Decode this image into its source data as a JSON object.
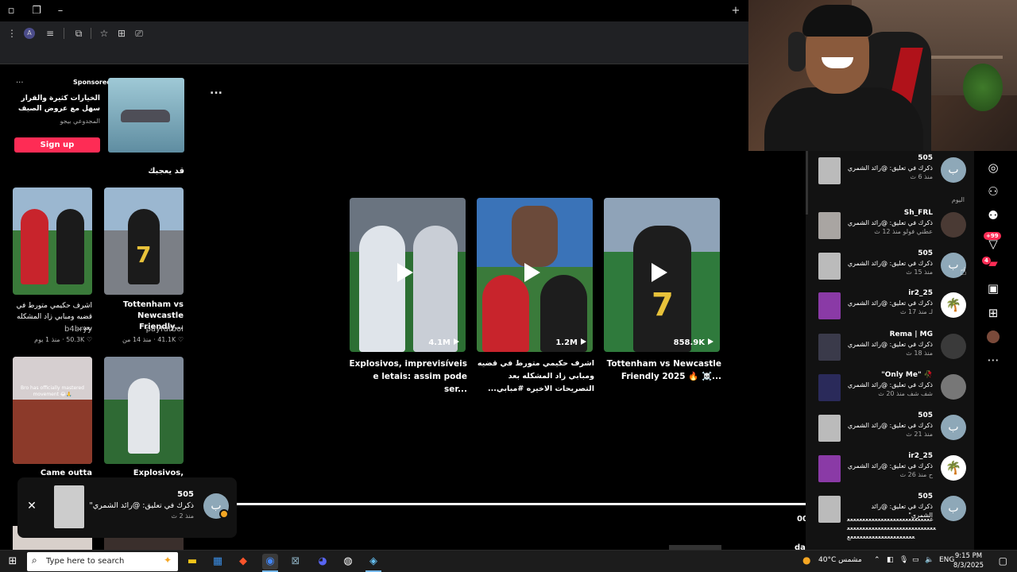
{
  "browser": {
    "titlebar_icons": [
      "browser-tabs-icon",
      "minimize-icon"
    ],
    "new_tab": "+",
    "toolbar_icons": [
      "menu-icon",
      "profile-icon",
      "reader-icon",
      "extensions-icon",
      "star-icon",
      "collections-icon",
      "screenshot-icon"
    ]
  },
  "sponsored": {
    "label": "Sponsored",
    "dots": "...",
    "text": "الخيارات كثيرة والقرار سهل مع عروض الصيف",
    "advertiser": "المجدوعي بيجو",
    "button": "Sign up"
  },
  "more_dots": "...",
  "suggested_title": "قد يعجبك",
  "grid": [
    {
      "title": "اشرف حكيمي متورط في قضيه ومبابي زاد المشكله بعد...",
      "author": "b4bryy",
      "likes": "50.3K",
      "time": "منذ 1 يوم"
    },
    {
      "title": "Tottenham vs Newcastle Friendly...",
      "author": "payfutbol",
      "likes": "41.1K",
      "time": "منذ 14 من"
    },
    {
      "title": "Came outta",
      "overlay": "Bro has officially mastered movement 😂🙏"
    },
    {
      "title": "Explosivos,"
    }
  ],
  "videos": [
    {
      "views": "4.1M",
      "title": "Explosivos, imprevisíveis e letais: assim pode ser..."
    },
    {
      "views": "1.2M",
      "title": "اشرف حكيمي متورط في قضيه ومبابي زاد المشكله بعد التصريحات الاخيره #مبابي..."
    },
    {
      "views": "858.9K",
      "title": "Tottenham vs Newcastle Friendly 2025 🔥 ☠️..."
    }
  ],
  "jersey_number": "7",
  "partial_time": "00",
  "partial_da": "da",
  "toast": {
    "name": "505",
    "text": "ذكرك في تعليق: @رائد الشمري\"",
    "time": "منذ 2 ث",
    "avatar_letter": "ب",
    "close": "✕"
  },
  "notifications": {
    "section_today": "اليوم",
    "items": [
      {
        "name": "505",
        "text": "ذكرك في تعليق: @رائد الشمري",
        "time": "منذ 6 ث",
        "avatar": "ب"
      },
      {
        "name": "Sh_FRL",
        "text": "ذكرك في تعليق: @رائد الشمري",
        "time": "عطني فولو منذ 12 ث",
        "avatar": ""
      },
      {
        "name": "505",
        "text": "ذكرك في تعليق: @رائد الشمري",
        "time": "منذ 15 ث",
        "avatar": "ب"
      },
      {
        "name": "ir2_25",
        "text": "ذكرك في تعليق: @رائد الشمري",
        "time": "لـ منذ 17 ث",
        "avatar": "🌴"
      },
      {
        "name": "Rema | MG",
        "text": "ذكرك في تعليق: @رائد الشمري",
        "time": "منذ 18 ث",
        "avatar": ""
      },
      {
        "name": "\"Only Me\" 🥀",
        "text": "ذكرك في تعليق: @رائد الشمري",
        "time": "شف شف منذ 20 ث",
        "avatar": ""
      },
      {
        "name": "505",
        "text": "ذكرك في تعليق: @رائد الشمري",
        "time": "منذ 21 ث",
        "avatar": "ب"
      },
      {
        "name": "ir2_25",
        "text": "ذكرك في تعليق: @رائد الشمري",
        "time": "ح منذ 26 ث",
        "avatar": "🌴"
      },
      {
        "name": "505",
        "text": "ذكرك في تعليق: @رائد الشمري\"",
        "time": "",
        "avatar": "ب"
      }
    ],
    "spam_text": "ععععععععععععععععععععععععععععععععععععععععععععععععععععععععععععععععععععععععععععععع"
  },
  "rail": {
    "icons": [
      "compass-icon",
      "add-friend-icon",
      "friends-icon",
      "send-icon",
      "inbox-icon",
      "live-icon",
      "upload-icon",
      "more-icon"
    ],
    "badge_99": "+99",
    "badge_inbox": "4"
  },
  "taskbar": {
    "search_placeholder": "Type here to search",
    "weather": "40°C مشمس",
    "lang": "ENG",
    "time": "9:15 PM",
    "date": "8/3/2025"
  },
  "colors": {
    "accent": "#fe2c55",
    "panel": "#121212",
    "taskbar": "#1c1c1c"
  }
}
